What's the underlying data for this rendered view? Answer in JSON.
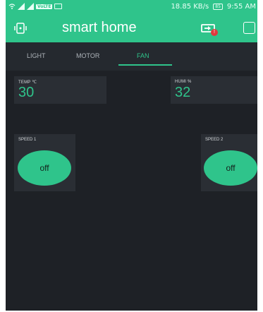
{
  "status_bar": {
    "carrier_label": "VoLTE",
    "network_speed": "18.85 KB/s",
    "battery_label": "85",
    "time": "9:55 AM"
  },
  "app_bar": {
    "title": "smart home",
    "badge_count": "!"
  },
  "tabs": [
    {
      "label": "LIGHT",
      "active": false
    },
    {
      "label": "MOTOR",
      "active": false
    },
    {
      "label": "FAN",
      "active": true
    }
  ],
  "displays": {
    "temp": {
      "label": "TEMP ℃",
      "value": "30"
    },
    "humi": {
      "label": "HUMI %",
      "value": "32"
    }
  },
  "buttons": {
    "speed1": {
      "label": "SPEED 1",
      "state": "off"
    },
    "speed2": {
      "label": "SPEED 2",
      "state": "off"
    }
  },
  "colors": {
    "accent": "#2fc48b",
    "background": "#1e2126",
    "widget_bg": "#2a2e34",
    "badge": "#e0393e"
  }
}
